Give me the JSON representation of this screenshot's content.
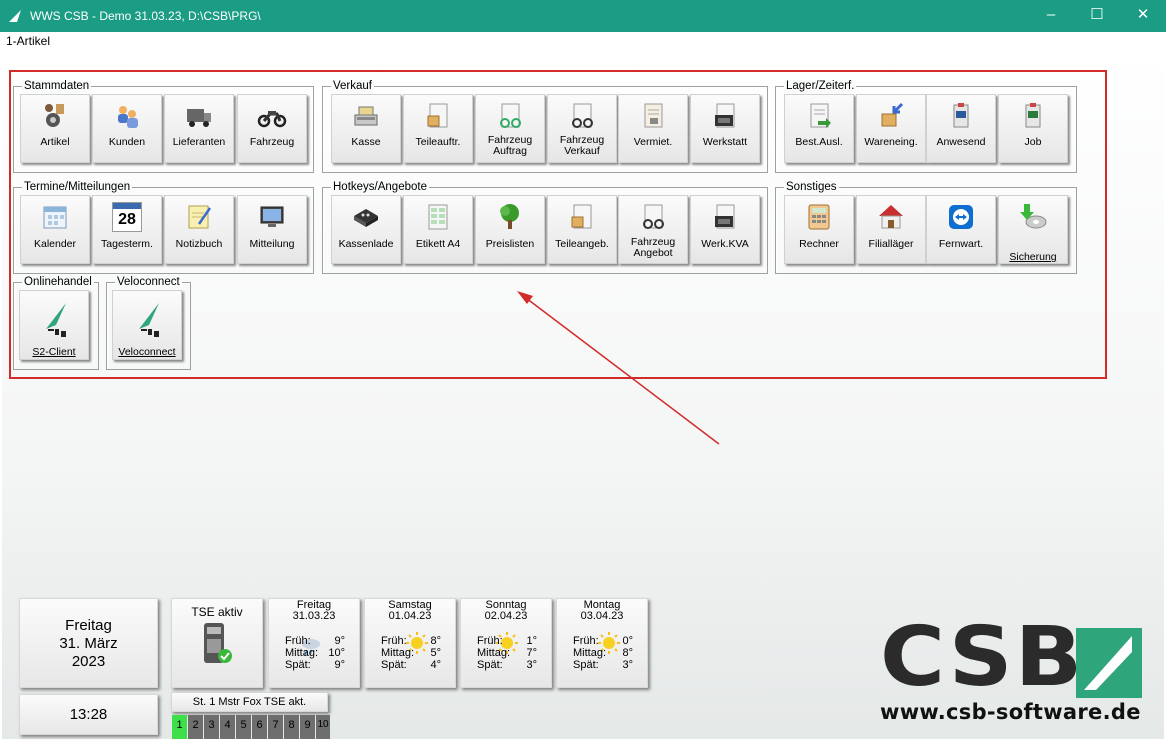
{
  "window": {
    "title": "WWS CSB - Demo  31.03.23, D:\\CSB\\PRG\\"
  },
  "menu": {
    "artikel_label": "1-Artikel"
  },
  "groups": {
    "stammdaten": {
      "title": "Stammdaten",
      "buttons": [
        "Artikel",
        "Kunden",
        "Lieferanten",
        "Fahrzeug"
      ]
    },
    "verkauf": {
      "title": "Verkauf",
      "buttons": [
        "Kasse",
        "Teileauftr.",
        "Fahrzeug Auftrag",
        "Fahrzeug Verkauf",
        "Vermiet.",
        "Werkstatt"
      ]
    },
    "lager": {
      "title": "Lager/Zeiterf.",
      "buttons": [
        "Best.Ausl.",
        "Wareneing.",
        "Anwesend",
        "Job"
      ]
    },
    "termine": {
      "title": "Termine/Mitteilungen",
      "buttons": [
        "Kalender",
        "Tagesterm.",
        "Notizbuch",
        "Mitteilung"
      ]
    },
    "hotkeys": {
      "title": "Hotkeys/Angebote",
      "buttons": [
        "Kassenlade",
        "Etikett A4",
        "Preislisten",
        "Teileangeb.",
        "Fahrzeug Angebot",
        "Werk.KVA"
      ]
    },
    "sonstiges": {
      "title": "Sonstiges",
      "buttons": [
        "Rechner",
        "Filialläger",
        "Fernwart.",
        "Sicherung"
      ]
    },
    "onlinehandel": {
      "title": "Onlinehandel",
      "buttons": [
        "S2-Client"
      ]
    },
    "veloconnect": {
      "title": "Veloconnect",
      "buttons": [
        "Veloconnect"
      ]
    }
  },
  "icons": {
    "calendar_day": "28"
  },
  "date_panel": {
    "weekday": "Freitag",
    "day_month": "31. März",
    "year": "2023"
  },
  "clock": "13:28",
  "tse": {
    "label": "TSE aktiv",
    "status_text": "St. 1 Mstr Fox TSE akt."
  },
  "weather": [
    {
      "day": "Freitag",
      "date": "31.03.23",
      "rows": [
        [
          "Früh:",
          "9°"
        ],
        [
          "Mittag:",
          "10°"
        ],
        [
          "Spät:",
          "9°"
        ]
      ],
      "icon": "cloud-rain-icon"
    },
    {
      "day": "Samstag",
      "date": "01.04.23",
      "rows": [
        [
          "Früh:",
          "8°"
        ],
        [
          "Mittag:",
          "5°"
        ],
        [
          "Spät:",
          "4°"
        ]
      ],
      "icon": "sun-icon"
    },
    {
      "day": "Sonntag",
      "date": "02.04.23",
      "rows": [
        [
          "Früh:",
          "1°"
        ],
        [
          "Mittag:",
          "7°"
        ],
        [
          "Spät:",
          "3°"
        ]
      ],
      "icon": "sun-icon"
    },
    {
      "day": "Montag",
      "date": "03.04.23",
      "rows": [
        [
          "Früh:",
          "0°"
        ],
        [
          "Mittag:",
          "8°"
        ],
        [
          "Spät:",
          "3°"
        ]
      ],
      "icon": "sun-icon"
    }
  ],
  "stations": [
    "1",
    "2",
    "3",
    "4",
    "5",
    "6",
    "7",
    "8",
    "9",
    "10"
  ],
  "active_station": "1",
  "logo": {
    "text": "CSB",
    "url": "www.csb-software.de"
  },
  "colors": {
    "titlebar": "#1b9c85",
    "annotation_red": "#d32a2a",
    "active_station": "#3ee04a",
    "logo_dark": "#2b2b2b",
    "logo_green": "#2ea57a"
  }
}
